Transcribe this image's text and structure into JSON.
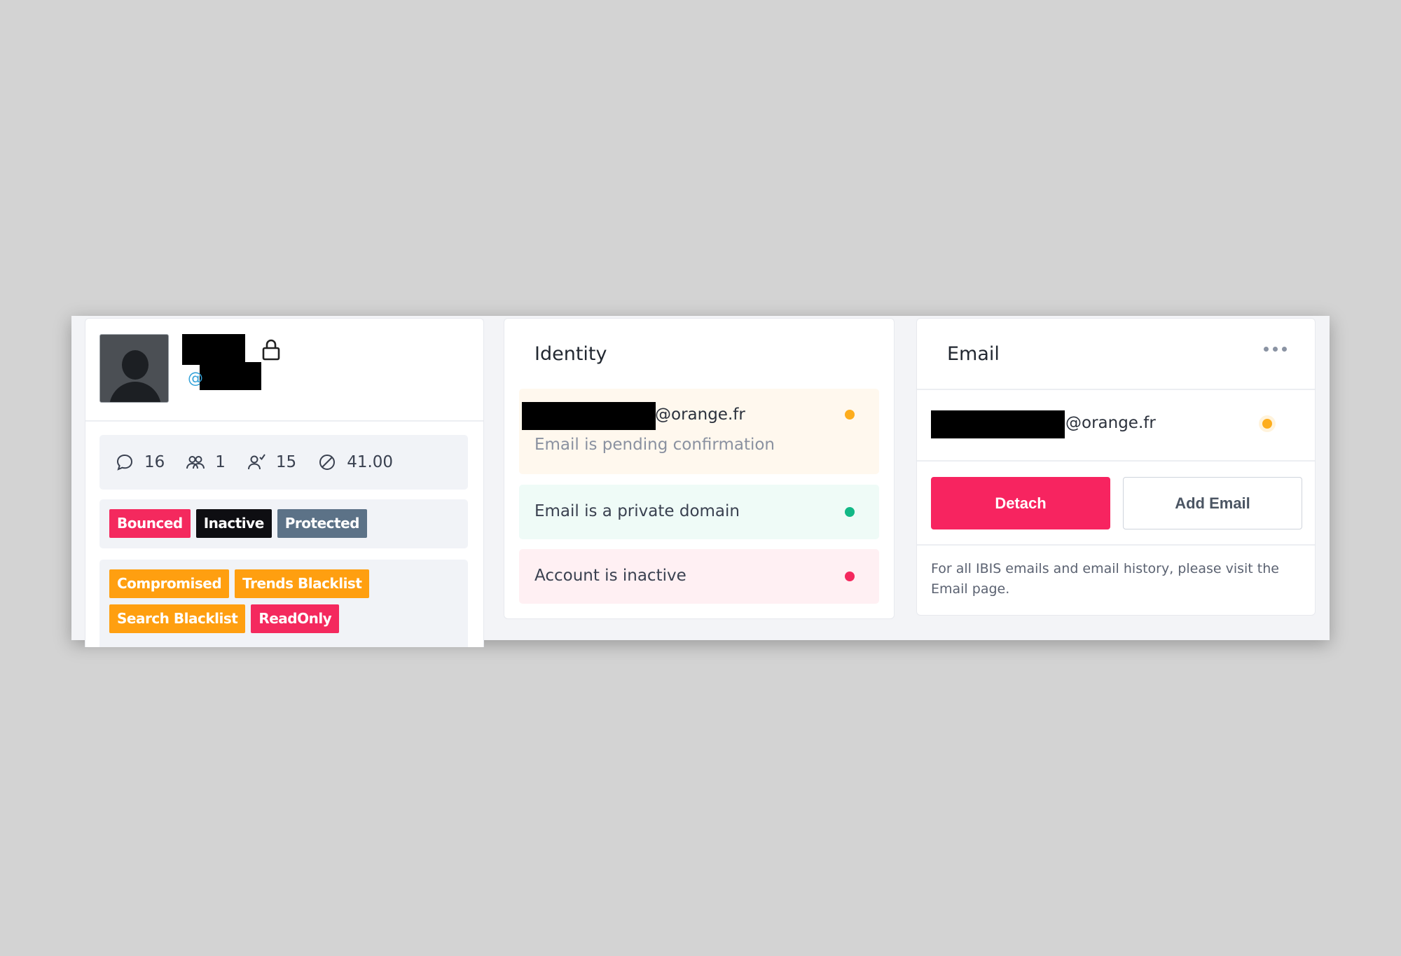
{
  "profile": {
    "avatar_icon": "user-silhouette-icon",
    "handle_prefix": "@",
    "lock_icon": "lock-icon",
    "stats": [
      {
        "icon": "comment-icon",
        "value": "16"
      },
      {
        "icon": "users-icon",
        "value": "1"
      },
      {
        "icon": "user-check-icon",
        "value": "15"
      },
      {
        "icon": "ban-icon",
        "value": "41.00"
      }
    ],
    "status_tags": [
      {
        "label": "Bounced",
        "color": "#f4295e"
      },
      {
        "label": "Inactive",
        "color": "#0e0e12"
      },
      {
        "label": "Protected",
        "color": "#5c7287"
      }
    ],
    "flag_tags": [
      {
        "label": "Compromised",
        "color": "#ff9f10"
      },
      {
        "label": "Trends Blacklist",
        "color": "#ff9f10"
      },
      {
        "label": "Search Blacklist",
        "color": "#ff9f10"
      },
      {
        "label": "ReadOnly",
        "color": "#f4295e"
      }
    ]
  },
  "identity": {
    "title": "Identity",
    "email_suffix": "@orange.fr",
    "rows": [
      {
        "text": "Email is pending confirmation",
        "status_color": "#fdad1d"
      },
      {
        "text": "Email is a private domain",
        "status_color": "#12b886"
      },
      {
        "text": "Account is inactive",
        "status_color": "#f4295e"
      }
    ]
  },
  "email": {
    "title": "Email",
    "menu_icon": "more-horizontal-icon",
    "address_suffix": "@orange.fr",
    "status_color": "#fdad1d",
    "detach_label": "Detach",
    "add_label": "Add Email",
    "note": "For all IBIS emails and email history, please visit the Email page."
  }
}
